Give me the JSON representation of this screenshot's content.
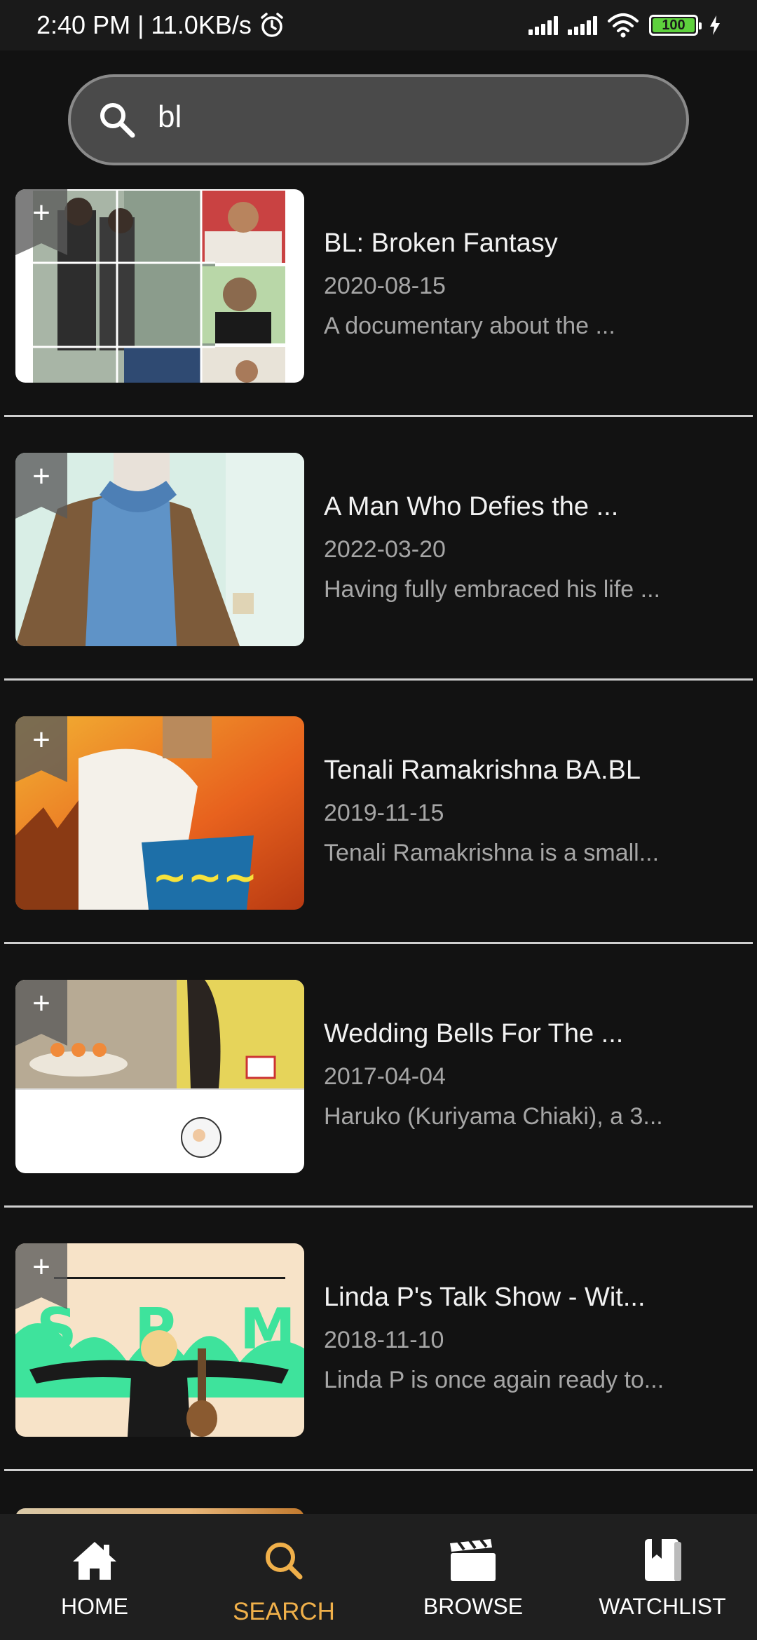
{
  "status_bar": {
    "text": "2:40 PM | 11.0KB/s",
    "battery": "100"
  },
  "search": {
    "value": "bl",
    "placeholder": ""
  },
  "results": [
    {
      "title": "BL: Broken Fantasy",
      "date": "2020-08-15",
      "description": "A documentary about the ..."
    },
    {
      "title": "A Man Who Defies the ...",
      "date": "2022-03-20",
      "description": "Having fully embraced his life ..."
    },
    {
      "title": "Tenali Ramakrishna BA.BL",
      "date": "2019-11-15",
      "description": "Tenali Ramakrishna is a small..."
    },
    {
      "title": "Wedding Bells For The ...",
      "date": "2017-04-04",
      "description": "Haruko (Kuriyama Chiaki), a 3..."
    },
    {
      "title": "Linda P's Talk Show - Wit...",
      "date": "2018-11-10",
      "description": "Linda P is once again ready to..."
    }
  ],
  "add_symbol": "+",
  "bottom_nav": [
    {
      "label": "HOME",
      "icon": "home-icon",
      "active": false
    },
    {
      "label": "SEARCH",
      "icon": "search-icon",
      "active": true
    },
    {
      "label": "BROWSE",
      "icon": "clapperboard-icon",
      "active": false
    },
    {
      "label": "WATCHLIST",
      "icon": "book-icon",
      "active": false
    }
  ],
  "colors": {
    "background": "#121212",
    "accent": "#f0b04a",
    "nav_background": "#1f1f1f",
    "search_background": "#4a4a4a"
  }
}
